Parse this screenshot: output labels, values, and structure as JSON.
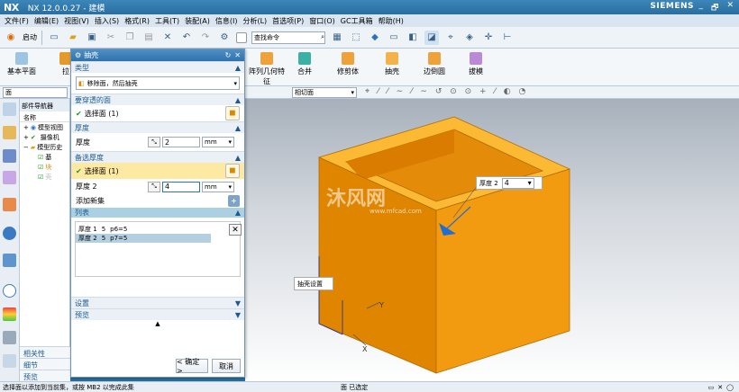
{
  "window": {
    "logo": "NX",
    "title": "NX 12.0.0.27 - 建模",
    "brand": "SIEMENS",
    "controls": [
      "_",
      "🗗",
      "✕"
    ]
  },
  "menu": [
    "文件(F)",
    "编辑(E)",
    "视图(V)",
    "插入(S)",
    "格式(R)",
    "工具(T)",
    "装配(A)",
    "信息(I)",
    "分析(L)",
    "首选项(P)",
    "窗口(O)",
    "GC工具箱",
    "帮助(H)"
  ],
  "toolbar": {
    "start_label": "启动",
    "command_search_placeholder": "查找命令"
  },
  "ribbon": {
    "items": [
      "基本平面",
      "拉",
      "阵列几何特征",
      "合并",
      "修剪体",
      "抽壳",
      "边倒圆",
      "拔模"
    ]
  },
  "filter": {
    "type_filter": "面",
    "mode_filter": "相切面"
  },
  "navigator": {
    "title": "部件导航器",
    "col_name": "名称",
    "rows": [
      "模型视图",
      "摄像机",
      "模型历史",
      "基",
      "块",
      "壳"
    ],
    "bottom": [
      "相关性",
      "细节",
      "预览"
    ]
  },
  "dialog": {
    "title": "抽壳",
    "type_label": "类型",
    "type_value": "移除面，然后抽壳",
    "pierce_label": "要穿透的面",
    "pierce_value": "选择面 (1)",
    "thickness_label": "厚度",
    "thickness_row": "厚度",
    "thickness_value": "2",
    "unit": "mm",
    "alt_label": "备选厚度",
    "alt_select": "选择面 (1)",
    "thickness2_label": "厚度 2",
    "thickness2_value": "4",
    "add_new": "添加新集",
    "list_label": "列表",
    "list_rows": [
      {
        "name": "厚度 1",
        "v": "5",
        "p": "p6=5"
      },
      {
        "name": "厚度 2",
        "v": "5",
        "p": "p7=5"
      }
    ],
    "settings": "设置",
    "preview": "预览",
    "ok": "< 确定 >",
    "cancel": "取消"
  },
  "viewport": {
    "callout_thickness_label": "厚度 2",
    "callout_thickness_value": "4",
    "callout_shell": "抽壳设置",
    "axis_y": "Y",
    "axis_x": "X",
    "watermark_cn": "沐风网",
    "watermark_url": "www.mfcad.com"
  },
  "status": {
    "left": "选择面以添加到当前集，或按 MB2 以完成此集",
    "center": "面 已选定"
  },
  "colors": {
    "accent": "#2a6f9e",
    "box_front": "#e08500",
    "box_side": "#f29a10",
    "box_top": "#fbb934",
    "highlight": "#fde9a1"
  }
}
